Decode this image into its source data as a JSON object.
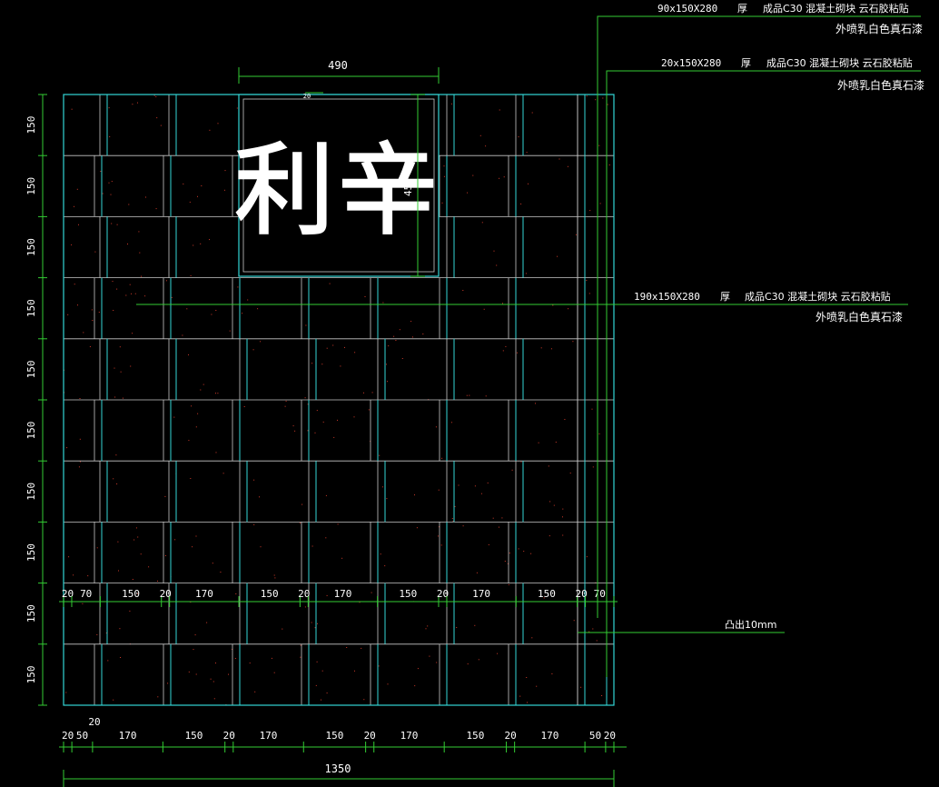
{
  "colors": {
    "background": "#000000",
    "wall_outline": "#33d6d6",
    "block_line": "#c8c8c8",
    "dimension": "#33cc33",
    "leader": "#33cc33",
    "text": "#ffffff",
    "speckle": "#cc3a2a"
  },
  "sign": {
    "text": "利辛",
    "width_label": "490",
    "height_label": "450",
    "small_label": "20"
  },
  "annotations": [
    {
      "spec": "90x150X280",
      "thickness": "厚",
      "material": "成品C30  混凝土砌块 云石胶粘贴",
      "finish": "外喷乳白色真石漆"
    },
    {
      "spec": "20x150X280",
      "thickness": "厚",
      "material": "成品C30  混凝土砌块 云石胶粘贴",
      "finish": "外喷乳白色真石漆"
    },
    {
      "spec": "190x150X280",
      "thickness": "厚",
      "material": "成品C30  混凝土砌块 云石胶粘贴",
      "finish": "外喷乳白色真石漆"
    }
  ],
  "protrusion_note": "凸出10mm",
  "left_dims": [
    "150",
    "150",
    "150",
    "150",
    "150",
    "150",
    "150",
    "150",
    "150",
    "150"
  ],
  "middle_dims": [
    "20",
    "70",
    "150",
    "20",
    "170",
    "150",
    "20",
    "170",
    "150",
    "20",
    "170",
    "150",
    "20",
    "70"
  ],
  "bottom_dims": [
    "20",
    "50",
    "170",
    "150",
    "20",
    "170",
    "150",
    "20",
    "170",
    "150",
    "20",
    "170",
    "50",
    "20"
  ],
  "bottom_extra": "20",
  "total_width": "1350"
}
